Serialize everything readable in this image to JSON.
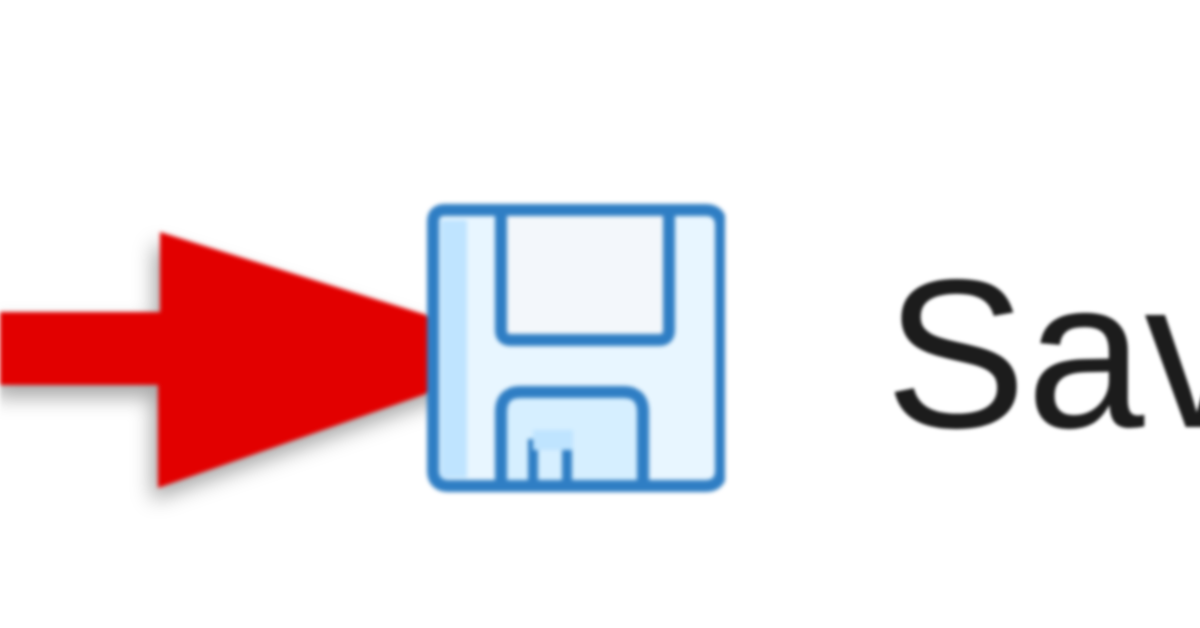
{
  "toolbar": {
    "save_label": "Save"
  },
  "icons": {
    "save": "floppy-disk-icon",
    "annotation": "red-arrow-icon"
  },
  "colors": {
    "arrow": "#e20000",
    "icon_stroke": "#2f7ec4",
    "icon_fill": "#e8f6ff",
    "text": "#1c1c1c"
  }
}
